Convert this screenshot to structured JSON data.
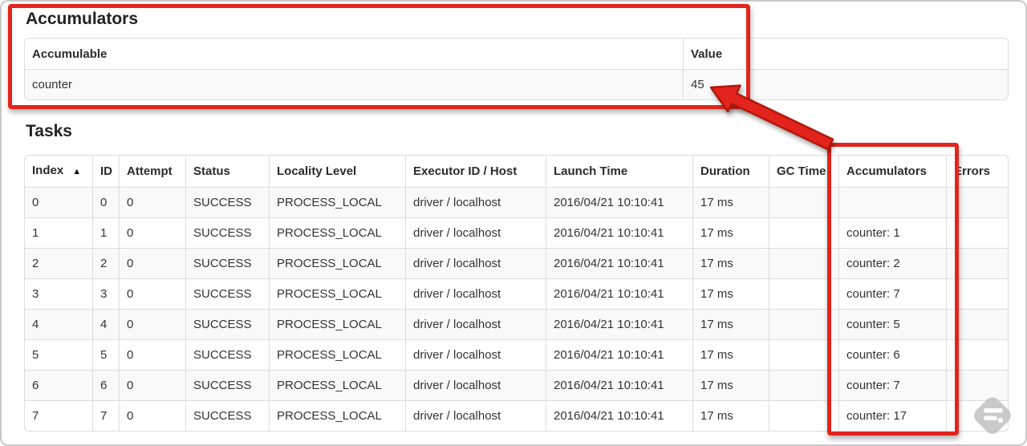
{
  "colors": {
    "annotation_red": "#e2241c",
    "annotation_red_outline": "#b2170c",
    "table_border": "#dddddd",
    "stripe_row_bg": "#f9f9f9",
    "text": "#333333"
  },
  "accumulators_section": {
    "title": "Accumulators",
    "table": {
      "headers": [
        "Accumulable",
        "Value"
      ],
      "rows": [
        [
          "counter",
          "45"
        ]
      ]
    }
  },
  "tasks_section": {
    "title": "Tasks",
    "table": {
      "sort": {
        "column": 0,
        "indicator": "▲",
        "direction": "ascending"
      },
      "headers": [
        "Index",
        "ID",
        "Attempt",
        "Status",
        "Locality Level",
        "Executor ID / Host",
        "Launch Time",
        "Duration",
        "GC Time",
        "Accumulators",
        "Errors"
      ],
      "rows": [
        [
          "0",
          "0",
          "0",
          "SUCCESS",
          "PROCESS_LOCAL",
          "driver / localhost",
          "2016/04/21 10:10:41",
          "17 ms",
          "",
          "",
          ""
        ],
        [
          "1",
          "1",
          "0",
          "SUCCESS",
          "PROCESS_LOCAL",
          "driver / localhost",
          "2016/04/21 10:10:41",
          "17 ms",
          "",
          "counter: 1",
          ""
        ],
        [
          "2",
          "2",
          "0",
          "SUCCESS",
          "PROCESS_LOCAL",
          "driver / localhost",
          "2016/04/21 10:10:41",
          "17 ms",
          "",
          "counter: 2",
          ""
        ],
        [
          "3",
          "3",
          "0",
          "SUCCESS",
          "PROCESS_LOCAL",
          "driver / localhost",
          "2016/04/21 10:10:41",
          "17 ms",
          "",
          "counter: 7",
          ""
        ],
        [
          "4",
          "4",
          "0",
          "SUCCESS",
          "PROCESS_LOCAL",
          "driver / localhost",
          "2016/04/21 10:10:41",
          "17 ms",
          "",
          "counter: 5",
          ""
        ],
        [
          "5",
          "5",
          "0",
          "SUCCESS",
          "PROCESS_LOCAL",
          "driver / localhost",
          "2016/04/21 10:10:41",
          "17 ms",
          "",
          "counter: 6",
          ""
        ],
        [
          "6",
          "6",
          "0",
          "SUCCESS",
          "PROCESS_LOCAL",
          "driver / localhost",
          "2016/04/21 10:10:41",
          "17 ms",
          "",
          "counter: 7",
          ""
        ],
        [
          "7",
          "7",
          "0",
          "SUCCESS",
          "PROCESS_LOCAL",
          "driver / localhost",
          "2016/04/21 10:10:41",
          "17 ms",
          "",
          "counter: 17",
          ""
        ]
      ]
    }
  }
}
